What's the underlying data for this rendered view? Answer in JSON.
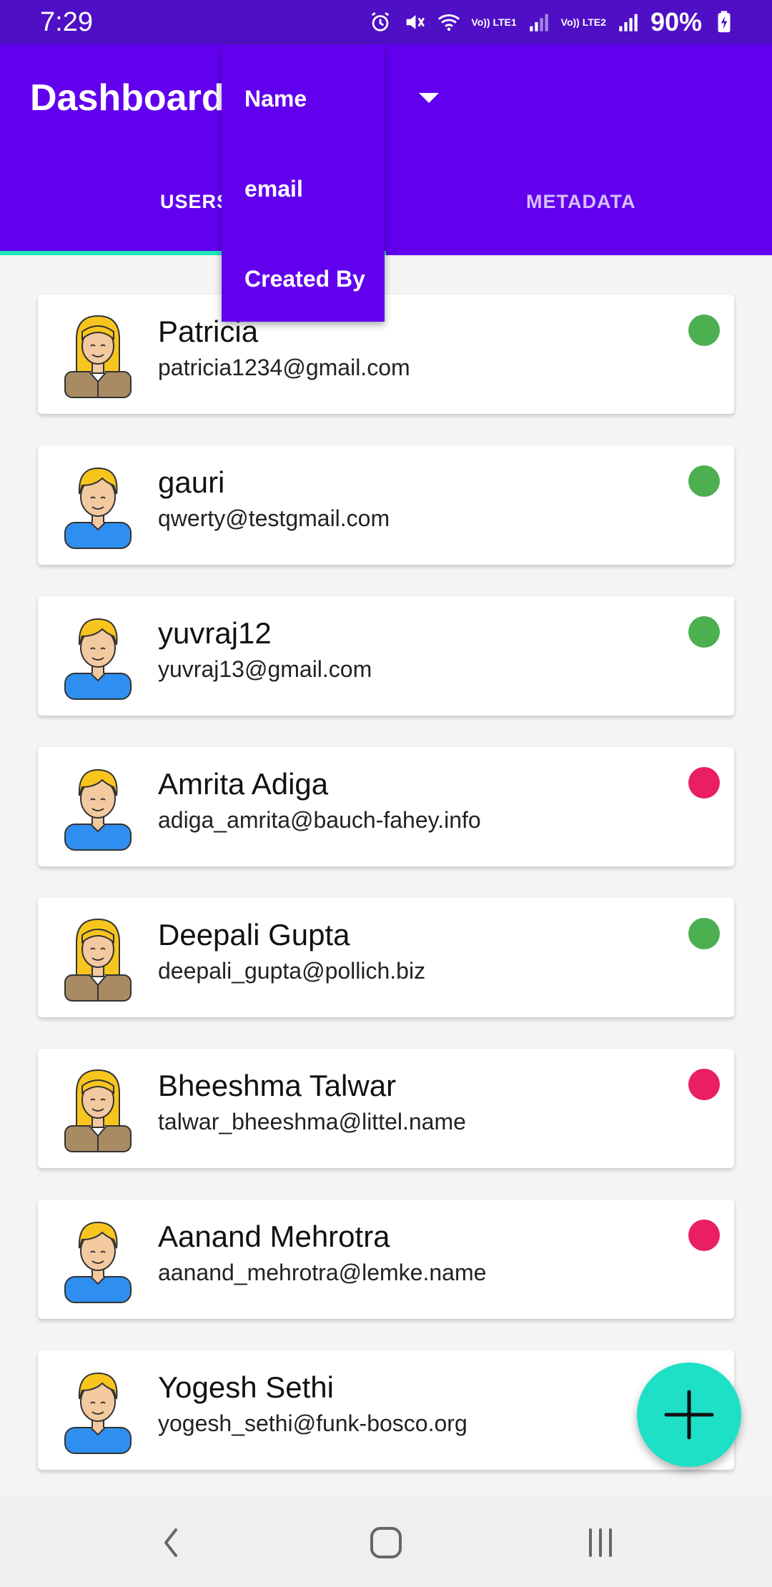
{
  "status_bar": {
    "time": "7:29",
    "sim1_label": "Vo)) LTE1",
    "sim2_label": "Vo)) LTE2",
    "battery": "90%"
  },
  "app_bar": {
    "title": "Dashboard",
    "tabs": [
      {
        "label": "USERS",
        "selected": true
      },
      {
        "label": "METADATA",
        "selected": false
      }
    ]
  },
  "sort_menu": {
    "options": [
      "Name",
      "email",
      "Created By"
    ]
  },
  "users": [
    {
      "name": "Patricia",
      "email": "patricia1234@gmail.com",
      "avatar": "female-avatar-icon",
      "status": "active"
    },
    {
      "name": "gauri",
      "email": "qwerty@testgmail.com",
      "avatar": "male-avatar-icon",
      "status": "active"
    },
    {
      "name": "yuvraj12",
      "email": "yuvraj13@gmail.com",
      "avatar": "male-avatar-icon",
      "status": "active"
    },
    {
      "name": "Amrita Adiga",
      "email": "adiga_amrita@bauch-fahey.info",
      "avatar": "male-avatar-icon",
      "status": "inactive"
    },
    {
      "name": "Deepali Gupta",
      "email": "deepali_gupta@pollich.biz",
      "avatar": "female-avatar-icon",
      "status": "active"
    },
    {
      "name": "Bheeshma Talwar",
      "email": "talwar_bheeshma@littel.name",
      "avatar": "female-avatar-icon",
      "status": "inactive"
    },
    {
      "name": "Aanand Mehrotra",
      "email": "aanand_mehrotra@lemke.name",
      "avatar": "male-avatar-icon",
      "status": "inactive"
    },
    {
      "name": "Yogesh Sethi",
      "email": "yogesh_sethi@funk-bosco.org",
      "avatar": "male-avatar-icon",
      "status": "active"
    }
  ],
  "colors": {
    "primary": "#6200ee",
    "status_bar": "#4f0fc4",
    "accent": "#1de9b6",
    "active_dot": "#4caf50",
    "inactive_dot": "#e91e63"
  },
  "fab": {
    "icon": "plus-icon"
  },
  "nav_bar": {
    "icons": [
      "back-icon",
      "home-icon",
      "recent-apps-icon"
    ]
  }
}
